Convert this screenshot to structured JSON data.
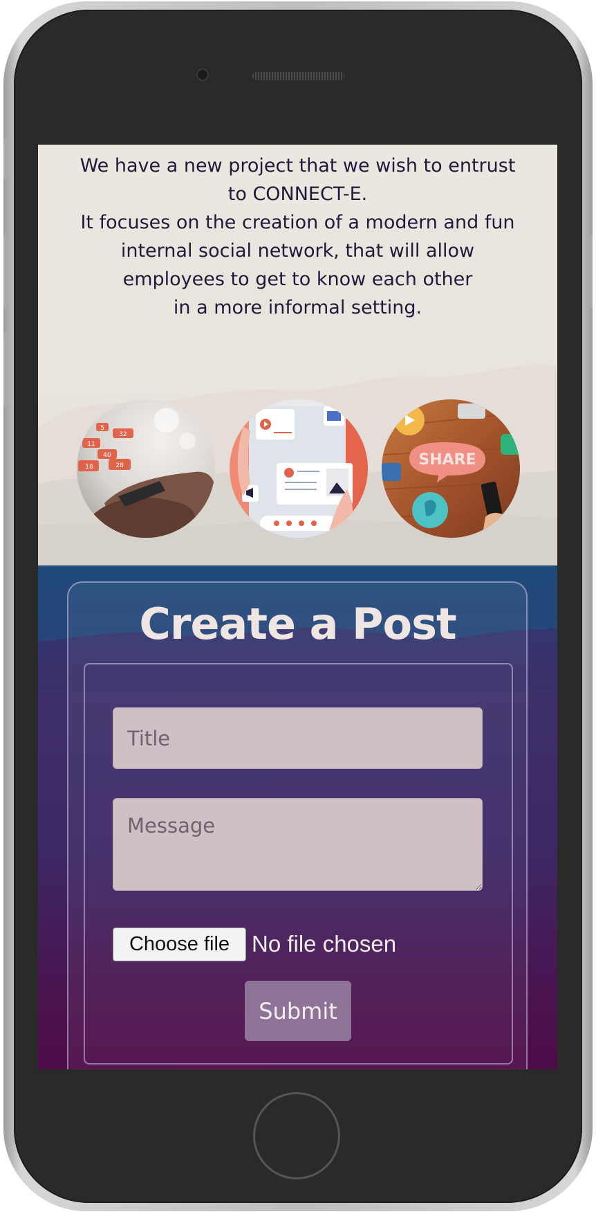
{
  "intro": {
    "lines": [
      "We have a new project that we wish to entrust",
      "to CONNECT-E.",
      "It focuses on the creation of a modern and fun",
      "internal social network, that will allow",
      "employees to get to know each other",
      "in a more informal setting."
    ]
  },
  "images": [
    {
      "name": "social-notifications-hands-photo",
      "badges": [
        "5",
        "32",
        "11",
        "40",
        "18",
        "28"
      ]
    },
    {
      "name": "social-media-app-illustration"
    },
    {
      "name": "share-speech-bubble-photo",
      "text": "SHARE"
    }
  ],
  "form": {
    "title": "Create a Post",
    "title_placeholder": "Title",
    "message_placeholder": "Message",
    "file_button_label": "Choose file",
    "file_status": "No file chosen",
    "submit_label": "Submit"
  },
  "colors": {
    "hero_bg": "#eae4df",
    "text_dark": "#1f1b3a",
    "accent_red": "#e0644c",
    "form_top": "#1f4a7a",
    "form_bottom": "#4e0b4a",
    "submit_bg": "#8f7397"
  }
}
